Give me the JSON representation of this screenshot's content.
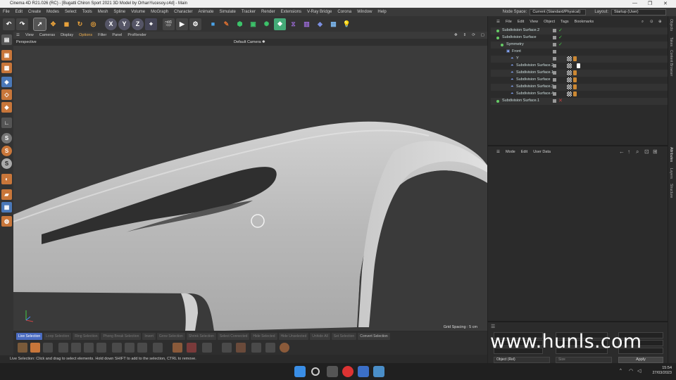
{
  "window": {
    "title": "Cinema 4D R21.026 (RC) - [Bugatti Chiron Sport 2021 3D Model by OrhanYucesoy.c4d] - Main"
  },
  "menubar": {
    "items": [
      "File",
      "Edit",
      "Create",
      "Modes",
      "Select",
      "Tools",
      "Mesh",
      "Spline",
      "Volume",
      "MoGraph",
      "Character",
      "Animate",
      "Simulate",
      "Tracker",
      "Render",
      "Extensions",
      "V-Ray Bridge",
      "Corona",
      "Window",
      "Help"
    ],
    "node_space_label": "Node Space:",
    "node_space_value": "Current (Standard/Physical)",
    "layout_label": "Layout:",
    "layout_value": "Startup (User)"
  },
  "viewport": {
    "menu": [
      "View",
      "Cameras",
      "Display",
      "Options",
      "Filter",
      "Panel",
      "ProRender"
    ],
    "view_name": "Perspective",
    "camera": "Default Camera ✱",
    "grid_spacing": "Grid Spacing : 5 cm"
  },
  "modes": [
    "Live Selection",
    "Loop Selection",
    "Ring Selection",
    "Phong Break Selection",
    "Invert",
    "Grow Selection",
    "Shrink Selection",
    "Select Connected",
    "Hide Selected",
    "Hide Unselected",
    "Unhide All",
    "Set Selection",
    "Convert Selection"
  ],
  "status_text": "Live Selection: Click and drag to select elements. Hold down SHIFT to add to the selection, CTRL to remove.",
  "object_manager": {
    "menu": [
      "File",
      "Edit",
      "View",
      "Object",
      "Tags",
      "Bookmarks"
    ],
    "rows": [
      {
        "name": "Subdivision Surface.2",
        "indent": 0
      },
      {
        "name": "Subdivision Surface",
        "indent": 0
      },
      {
        "name": "Symmetry",
        "indent": 1
      },
      {
        "name": "Front",
        "indent": 2
      },
      {
        "name": "Y",
        "indent": 3
      },
      {
        "name": "Subdivision Surface.2",
        "indent": 3
      },
      {
        "name": "Subdivision Surface.1",
        "indent": 3
      },
      {
        "name": "Subdivision Surface",
        "indent": 3
      },
      {
        "name": "Subdivision Surface.3",
        "indent": 3
      },
      {
        "name": "Subdivision Surface.4",
        "indent": 3
      },
      {
        "name": "Subdivision Surface.1",
        "indent": 0
      }
    ]
  },
  "attribute_manager": {
    "menu": [
      "Mode",
      "Edit",
      "User Data"
    ]
  },
  "coordinates": {
    "object_dropdown": "Object (Rel)",
    "size_dropdown": "Size",
    "apply_label": "Apply"
  },
  "side_tabs": [
    "Objects",
    "Takes",
    "Content Browser",
    "Attributes",
    "Layers",
    "Structure"
  ],
  "watermark": "www.hunls.com",
  "tray": {
    "time": "15:54",
    "date": "27/03/2023"
  }
}
